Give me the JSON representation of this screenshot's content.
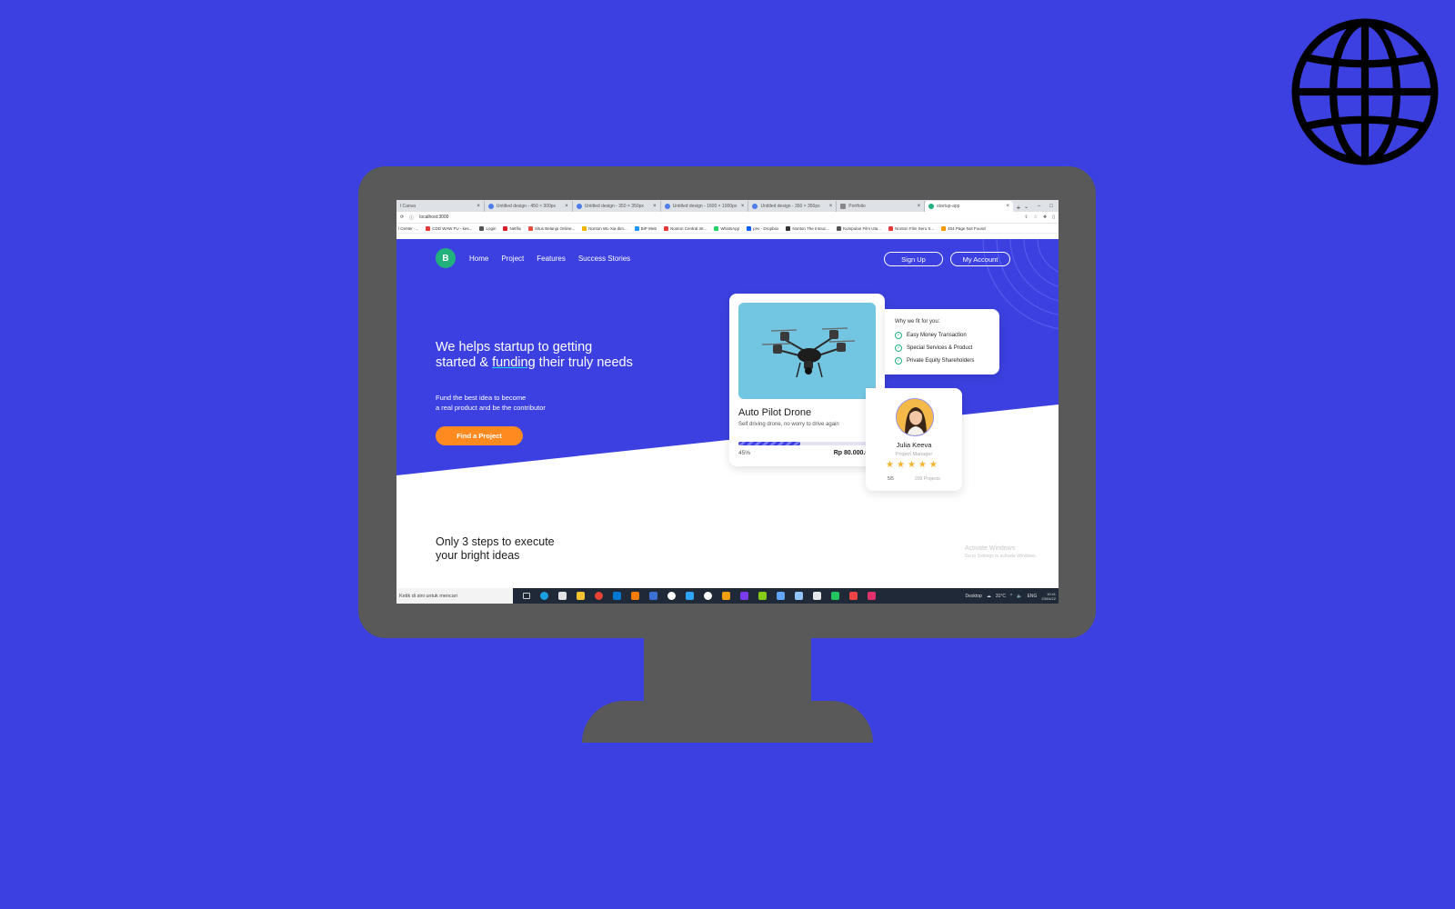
{
  "browser": {
    "tabs": [
      {
        "label": "l Canva",
        "active": false
      },
      {
        "label": "Untitled design - 450 × 300px",
        "active": false
      },
      {
        "label": "Untitled design - 350 × 350px",
        "active": false
      },
      {
        "label": "Untitled design - 1600 × 1000px",
        "active": false
      },
      {
        "label": "Untitled design - 350 × 350px",
        "active": false
      },
      {
        "label": "Portfolio",
        "active": false
      },
      {
        "label": "startup-app",
        "active": true
      }
    ],
    "url": "localhost:3000",
    "bookmarks": [
      "l Center -...",
      "CDD WAW FU - kes...",
      "Login",
      "Netflix",
      "Situs Belanja Online...",
      "Nonton Wu Xia dim...",
      "BiP Web",
      "Nonton Central Int...",
      "WhatsApp",
      "pnv - Dropbox",
      "Nonton The Intouc...",
      "Kumpulan Film Uta...",
      "Nonton Film Seru S...",
      "404 Page Not Found"
    ]
  },
  "site": {
    "logo_letter": "B",
    "nav": [
      "Home",
      "Project",
      "Features",
      "Success Stories"
    ],
    "signup_label": "Sign Up",
    "account_label": "My Account",
    "hero": {
      "title_part1": "We helps startup to getting started & ",
      "title_highlight": "funding",
      "title_part2": " their truly needs",
      "subtitle_line1": "Fund the best idea to become",
      "subtitle_line2": "a real product and be the contributor",
      "cta_label": "Find a Project"
    },
    "project_card": {
      "title": "Auto Pilot Drone",
      "description": "Self driving drone, no worry to drive again",
      "progress": 0.45,
      "progress_label": "45%",
      "amount": "Rp 80.000.000"
    },
    "fit_card": {
      "title": "Why we fit for you:",
      "items": [
        "Easy Money Transaction",
        "Special Services & Product",
        "Private Equity Shareholders"
      ]
    },
    "person_card": {
      "name": "Julia Keeva",
      "role": "Project Manager",
      "stars": 5,
      "rating": "5/5",
      "projects": "200 Projects"
    },
    "steps_title_line1": "Only 3 steps to execute",
    "steps_title_line2": "your bright ideas",
    "watermark_title": "Activate Windows",
    "watermark_sub": "Go to Settings to activate Windows."
  },
  "taskbar": {
    "search_placeholder": "Ketik di sini untuk mencari",
    "desktop_label": "Desktop",
    "weather": "31°C",
    "lang": "ENG",
    "time": "10:41",
    "date": "23/04/22"
  },
  "colors": {
    "background": "#3c40e0",
    "accent_orange": "#ff8a1f",
    "accent_green": "#22b07d",
    "monitor": "#595959",
    "star": "#f8b32c"
  }
}
